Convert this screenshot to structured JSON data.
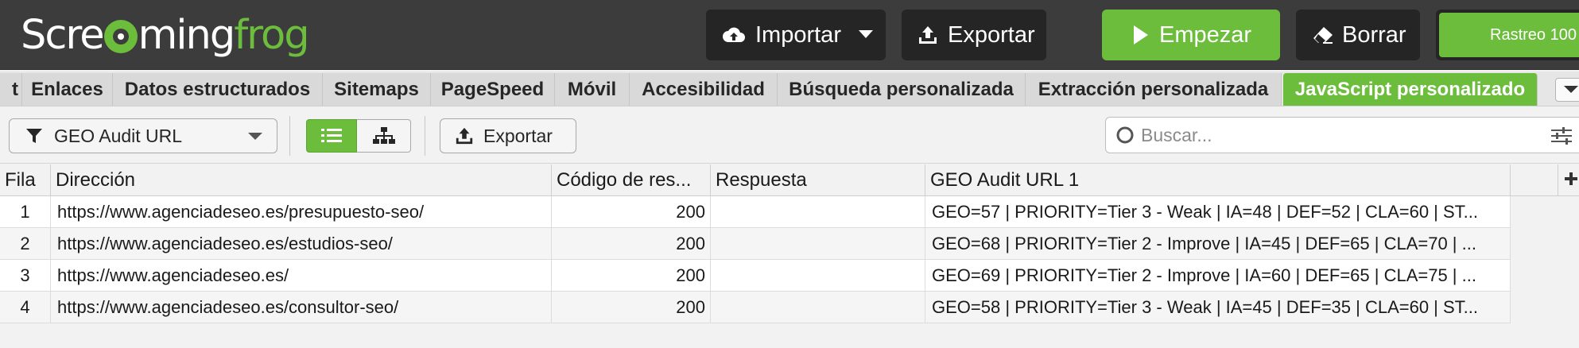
{
  "header": {
    "logo_text_1": "Scre",
    "logo_text_2": "ming",
    "logo_text_3": "frog",
    "import_label": "Importar",
    "export_label": "Exportar",
    "start_label": "Empezar",
    "clear_label": "Borrar",
    "crawl_label": "Rastreo 100"
  },
  "tabs": [
    {
      "label": "t"
    },
    {
      "label": "Enlaces"
    },
    {
      "label": "Datos estructurados"
    },
    {
      "label": "Sitemaps"
    },
    {
      "label": "PageSpeed"
    },
    {
      "label": "Móvil"
    },
    {
      "label": "Accesibilidad"
    },
    {
      "label": "Búsqueda personalizada"
    },
    {
      "label": "Extracción personalizada"
    },
    {
      "label": "JavaScript personalizado"
    }
  ],
  "toolbar": {
    "filter_value": "GEO Audit URL",
    "export_label": "Exportar",
    "search_placeholder": "Buscar..."
  },
  "table": {
    "columns": [
      "Fila",
      "Dirección",
      "Código de res...",
      "Respuesta",
      "GEO Audit URL 1",
      ""
    ],
    "rows": [
      {
        "fila": "1",
        "direccion": "https://www.agenciadeseo.es/presupuesto-seo/",
        "codigo": "200",
        "respuesta": "",
        "geo": "GEO=57 | PRIORITY=Tier 3 - Weak | IA=48 | DEF=52 | CLA=60 | ST..."
      },
      {
        "fila": "2",
        "direccion": "https://www.agenciadeseo.es/estudios-seo/",
        "codigo": "200",
        "respuesta": "",
        "geo": "GEO=68 | PRIORITY=Tier 2 - Improve | IA=45 | DEF=65 | CLA=70 | ..."
      },
      {
        "fila": "3",
        "direccion": "https://www.agenciadeseo.es/",
        "codigo": "200",
        "respuesta": "",
        "geo": "GEO=69 | PRIORITY=Tier 2 - Improve | IA=60 | DEF=65 | CLA=75 | ..."
      },
      {
        "fila": "4",
        "direccion": "https://www.agenciadeseo.es/consultor-seo/",
        "codigo": "200",
        "respuesta": "",
        "geo": "GEO=58 | PRIORITY=Tier 3 - Weak | IA=45 | DEF=35 | CLA=60 | ST..."
      }
    ]
  },
  "icons": {
    "import": "cloud-upload-icon",
    "export": "upload-tray-icon",
    "start": "play-icon",
    "clear": "eraser-icon",
    "filter": "funnel-icon",
    "list_view": "list-icon",
    "tree_view": "tree-icon",
    "search": "search-icon",
    "settings": "sliders-icon",
    "add_column": "plus-icon",
    "tab_menu": "chevron-down-icon"
  },
  "colors": {
    "brand_green": "#6cbd3c",
    "header_bg": "#3c3c3c",
    "button_dark": "#252525"
  }
}
